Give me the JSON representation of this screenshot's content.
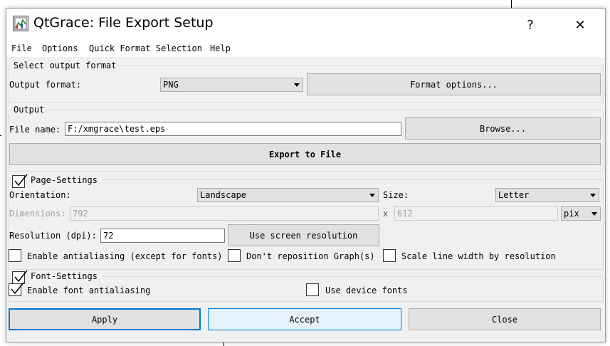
{
  "window": {
    "title": "QtGrace: File Export Setup",
    "help_glyph": "?",
    "close_glyph": "✕"
  },
  "menu": [
    "File",
    "Options",
    "Quick Format Selection",
    "Help"
  ],
  "format_group": {
    "title": "Select output format",
    "format_label": "Output format:",
    "format_value": "PNG",
    "format_options_button": "Format options..."
  },
  "output_group": {
    "title": "Output",
    "file_label": "File name:",
    "file_value": "F:/xmgrace\\test.eps",
    "browse_button": "Browse...",
    "export_button": "Export to File"
  },
  "page_settings": {
    "title": "Page-Settings",
    "checked": true,
    "orientation_label": "Orientation:",
    "orientation_value": "Landscape",
    "size_label": "Size:",
    "size_value": "Letter",
    "dimensions_label": "Dimensions:",
    "width_value": "792",
    "x_label": "x",
    "height_value": "612",
    "unit_value": "pix",
    "resolution_label": "Resolution (dpi):",
    "resolution_value": "72",
    "screen_resolution_button": "Use screen resolution",
    "antialias_label": "Enable antialiasing (except for fonts)",
    "antialias_checked": false,
    "reposition_label": "Don't reposition Graph(s)",
    "reposition_checked": false,
    "scale_line_label": "Scale line width by resolution",
    "scale_line_checked": false
  },
  "font_settings": {
    "title": "Font-Settings",
    "checked": true,
    "font_antialias_label": "Enable font antialiasing",
    "font_antialias_checked": true,
    "device_fonts_label": "Use device fonts",
    "device_fonts_checked": false
  },
  "buttons": {
    "apply": "Apply",
    "accept": "Accept",
    "close": "Close"
  },
  "colors": {
    "window_bg": "#f0f0f0",
    "button_bg": "#e1e1e1",
    "focus_border": "#0078d7",
    "accept_bg": "#e5f1fb"
  }
}
